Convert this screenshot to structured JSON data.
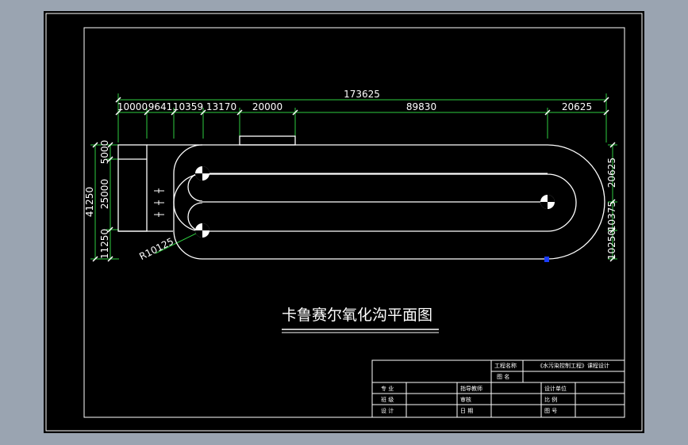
{
  "colors": {
    "screen_bg": "#9aa4b1",
    "paper": "#000000",
    "line": "#ffffff",
    "dimension": "#2ecc40",
    "marker": "#1a3cff"
  },
  "drawing": {
    "title": "卡鲁赛尔氧化沟平面图"
  },
  "dimensions": {
    "overall": "173625",
    "top": [
      "10000",
      "9641",
      "10359",
      "13170",
      "20000",
      "89830",
      "20625"
    ],
    "left_total": "41250",
    "left": [
      "5000",
      "25000",
      "11250"
    ],
    "right": [
      "20625",
      "10375",
      "10250"
    ],
    "radius": "R10125"
  },
  "title_block": {
    "row1_label": "工程名称",
    "row1_value": "《水污染控制工程》课程设计",
    "row2_label": "图 名",
    "row3": [
      "专 业",
      "指导教师",
      "设计单位"
    ],
    "row4": [
      "班 级",
      "审核",
      "比 例"
    ],
    "row5": [
      "设 计",
      "日 期",
      "图 号"
    ]
  }
}
